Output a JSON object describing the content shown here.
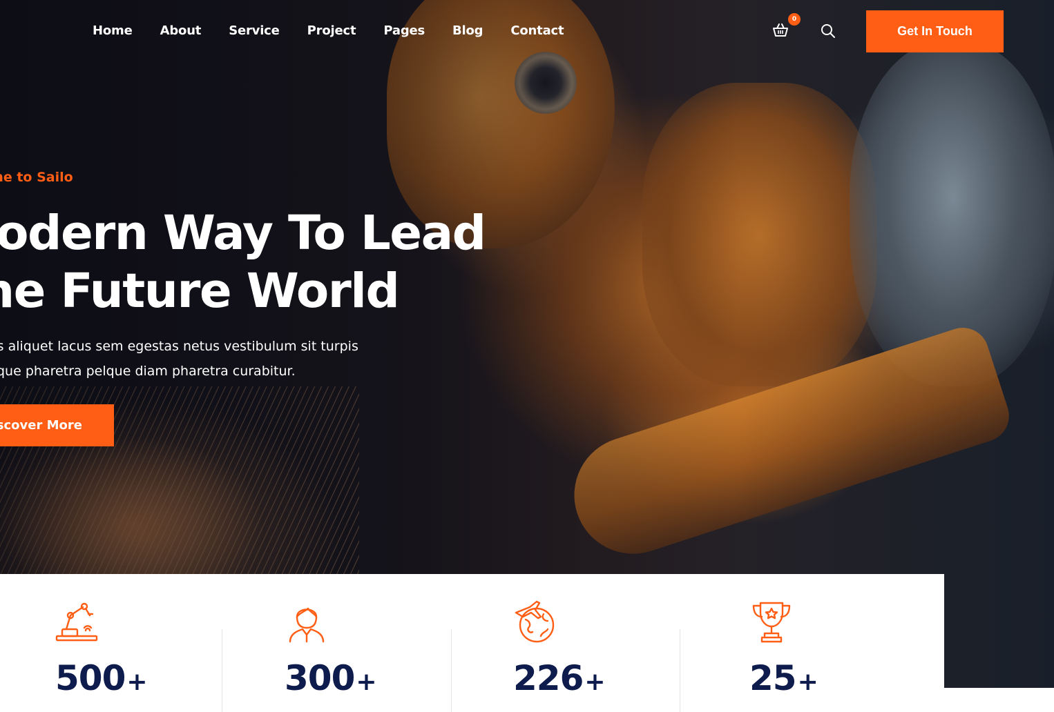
{
  "nav": {
    "items": [
      {
        "label": "Home"
      },
      {
        "label": "About"
      },
      {
        "label": "Service"
      },
      {
        "label": "Project"
      },
      {
        "label": "Pages"
      },
      {
        "label": "Blog"
      },
      {
        "label": "Contact"
      }
    ],
    "cart_count": "0",
    "cta_label": "Get In Touch"
  },
  "hero": {
    "eyebrow": "ome to Sailo",
    "headline_line1": "lodern Way To Lead",
    "headline_line2": "he Future World",
    "desc_line1": "ous aliquet lacus sem egestas netus vestibulum sit turpis",
    "desc_line2": "risque pharetra pelque diam pharetra curabitur.",
    "button_label": "Discover More"
  },
  "stats": [
    {
      "icon": "robot-arm-icon",
      "value": "500",
      "suffix": "+"
    },
    {
      "icon": "worker-icon",
      "value": "300",
      "suffix": "+"
    },
    {
      "icon": "globe-plane-icon",
      "value": "226",
      "suffix": "+"
    },
    {
      "icon": "trophy-icon",
      "value": "25",
      "suffix": "+"
    }
  ],
  "colors": {
    "accent": "#ff5e14",
    "number": "#0e1b4d"
  }
}
